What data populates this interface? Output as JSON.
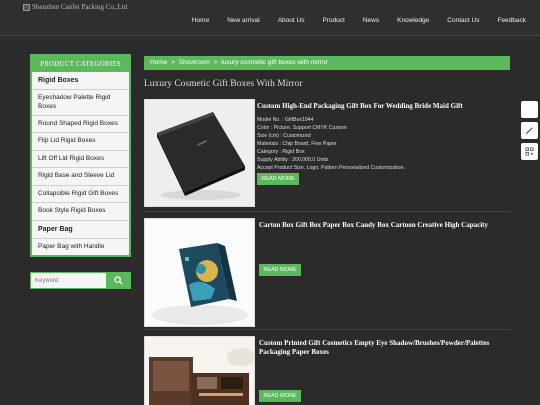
{
  "header": {
    "logo_alt": "Shenzhen Canfei Packing Co.,Ltd",
    "nav": [
      "Home",
      "New arrival",
      "About Us",
      "Product",
      "News",
      "Knowledge",
      "Contact Us",
      "Feedback"
    ]
  },
  "sidebar": {
    "title": "PRODUCT CATEGORIES",
    "items": [
      {
        "label": "Rigid Boxes",
        "bold": true
      },
      {
        "label": "Eyeshadow Palette Rigid Boxes",
        "bold": false
      },
      {
        "label": "Round Shaped Rigid Boxes",
        "bold": false
      },
      {
        "label": "Flip Lid Rigid Boxes",
        "bold": false
      },
      {
        "label": "Lift Off Lid Rigid Boxes",
        "bold": false
      },
      {
        "label": "Rigid Base and Sleeve Lid",
        "bold": false
      },
      {
        "label": "Collapsible Rigid Gift Boxes",
        "bold": false
      },
      {
        "label": "Book Style Rigid Boxes",
        "bold": false
      },
      {
        "label": "Paper Bag",
        "bold": true
      },
      {
        "label": "Paper Bag with Handle",
        "bold": false
      }
    ]
  },
  "search": {
    "placeholder": "Keyword"
  },
  "breadcrumb": {
    "home": "Home",
    "sep1": ">",
    "showroom": "Showroom",
    "sep2": ">",
    "current": "luxury cosmetic gift boxes with mirror"
  },
  "page_title": "Luxury Cosmetic Gift Boxes With Mirror",
  "products": [
    {
      "title": "Custom High-End Packaging Gift Box For Wedding Bride Maid Gift",
      "specs": [
        "Model No. : GiftBox1944",
        "Color : Picture, Support CMYK Custom",
        "Size (cm) : Customized",
        "Materials : Chip Board, Fine Paper",
        "Category : Rigid Box",
        "Supply Ability : 200,000,0 Units",
        "Accept Product Size, Logo, Pattern Personalized Customization."
      ],
      "button": "READ MORE"
    },
    {
      "title": "Carton Box Gift Box Paper Box Candy Box Cartoon Creative High Capacity",
      "specs": [],
      "button": "READ MORE"
    },
    {
      "title": "Custom Printed Gift Cosmetics Empty Eye Shadow/Brushes/Powder/Palettes Packaging Paper Boxes",
      "specs": [],
      "button": "READ MORE"
    }
  ],
  "colors": {
    "accent": "#5cb85c",
    "background": "#2b2b2b"
  },
  "icons": [
    "search-icon",
    "chat-icon",
    "edit-icon",
    "qr-code-icon"
  ]
}
